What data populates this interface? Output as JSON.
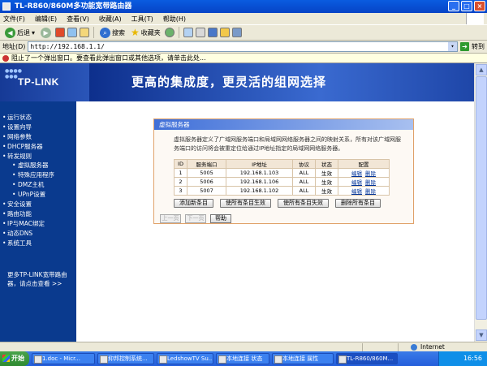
{
  "window": {
    "title": "TL-R860/860M多功能宽带路由器"
  },
  "menubar": [
    "文件(F)",
    "编辑(E)",
    "查看(V)",
    "收藏(A)",
    "工具(T)",
    "帮助(H)"
  ],
  "toolbar": {
    "back": "后退",
    "search": "搜索",
    "favorites": "收藏夹"
  },
  "address": {
    "label": "地址(D)",
    "url": "http://192.168.1.1/",
    "go": "转到"
  },
  "infobar": {
    "text": "阻止了一个弹出窗口。要查看此弹出窗口或其他选项，请单击此处..."
  },
  "banner": {
    "logo": "TP-LINK",
    "slogan": "更高的集成度，更灵活的组网选择"
  },
  "sidebar": {
    "items": [
      {
        "label": "运行状态",
        "sub": false
      },
      {
        "label": "设置向导",
        "sub": false
      },
      {
        "label": "网络参数",
        "sub": false
      },
      {
        "label": "DHCP服务器",
        "sub": false
      },
      {
        "label": "转发规则",
        "sub": false
      },
      {
        "label": "虚拟服务器",
        "sub": true
      },
      {
        "label": "特殊应用程序",
        "sub": true
      },
      {
        "label": "DMZ主机",
        "sub": true
      },
      {
        "label": "UPnP设置",
        "sub": true
      },
      {
        "label": "安全设置",
        "sub": false
      },
      {
        "label": "路由功能",
        "sub": false
      },
      {
        "label": "IP与MAC绑定",
        "sub": false
      },
      {
        "label": "动态DNS",
        "sub": false
      },
      {
        "label": "系统工具",
        "sub": false
      }
    ],
    "more": "更多TP-LINK宽带路由器，请点击查看 >>"
  },
  "panel": {
    "title": "虚拟服务器",
    "description": "虚拟服务器定义了广域网服务端口和局域网网络服务器之间的映射关系，所有对该广域网服务端口的访问将会被重定位给通过IP地址指定的局域网网络服务器。",
    "table": {
      "headers": [
        "ID",
        "服务端口",
        "IP地址",
        "协议",
        "状态",
        "配置"
      ],
      "rows": [
        {
          "id": "1",
          "port": "5005",
          "ip": "192.168.1.103",
          "protocol": "ALL",
          "status": "生效"
        },
        {
          "id": "2",
          "port": "5006",
          "ip": "192.168.1.106",
          "protocol": "ALL",
          "status": "生效"
        },
        {
          "id": "3",
          "port": "5007",
          "ip": "192.168.1.102",
          "protocol": "ALL",
          "status": "生效"
        }
      ],
      "edit_label": "编辑",
      "delete_label": "删除"
    },
    "buttons": [
      "添加新条目",
      "使所有条目生效",
      "使所有条目失效",
      "删除所有条目"
    ],
    "nav": {
      "prev": "上一页",
      "next": "下一页",
      "help": "帮助"
    }
  },
  "statusbar": {
    "zone": "Internet"
  },
  "taskbar": {
    "start": "开始",
    "tasks": [
      "1.doc - Micr...",
      "抑邦控制系统...",
      "LedshowTV Su...",
      "本地连接 状态",
      "本地连接 属性",
      "TL-R860/860M..."
    ],
    "time": "16:56"
  }
}
